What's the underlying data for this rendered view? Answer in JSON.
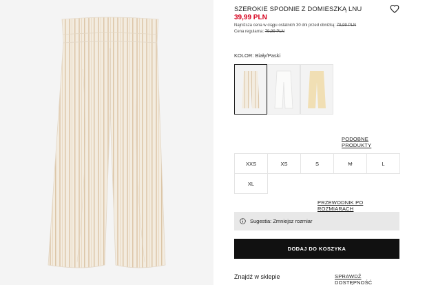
{
  "product": {
    "title": "SZEROKIE SPODNIE Z DOMIESZKĄ LNU",
    "price": "39,99 PLN",
    "lowest_price_label": "Najniższa cena w ciągu ostatnich 30 dni przed obniżką: ",
    "lowest_price_value": "79,99 PLN",
    "regular_price_label": "Cena regularna: ",
    "regular_price_value": "79,99 PLN",
    "favorite_icon": "heart-icon"
  },
  "color": {
    "label": "KOLOR: Biały/Paski",
    "swatches": [
      {
        "name": "Biały/Paski",
        "color": "#efe6d6",
        "selected": true
      },
      {
        "name": "Biały",
        "color": "#f4f4f2",
        "selected": false
      },
      {
        "name": "Żółty",
        "color": "#f1dfb4",
        "selected": false
      }
    ]
  },
  "links": {
    "similar": "PODOBNE PRODUKTY",
    "size_guide": "PRZEWODNIK PO ROZMIARACH",
    "check_availability": "SPRAWDŹ DOSTĘPNOŚĆ"
  },
  "sizes": [
    {
      "label": "XXS",
      "available": true
    },
    {
      "label": "XS",
      "available": true
    },
    {
      "label": "S",
      "available": true
    },
    {
      "label": "M",
      "available": false
    },
    {
      "label": "L",
      "available": true
    },
    {
      "label": "XL",
      "available": true
    }
  ],
  "notice": {
    "icon": "info-icon",
    "text": "Sugestia: Zmniejsz rozmiar"
  },
  "cart": {
    "add_label": "DODAJ DO KOSZYKA"
  },
  "store": {
    "label": "Znajdź w sklepie"
  }
}
